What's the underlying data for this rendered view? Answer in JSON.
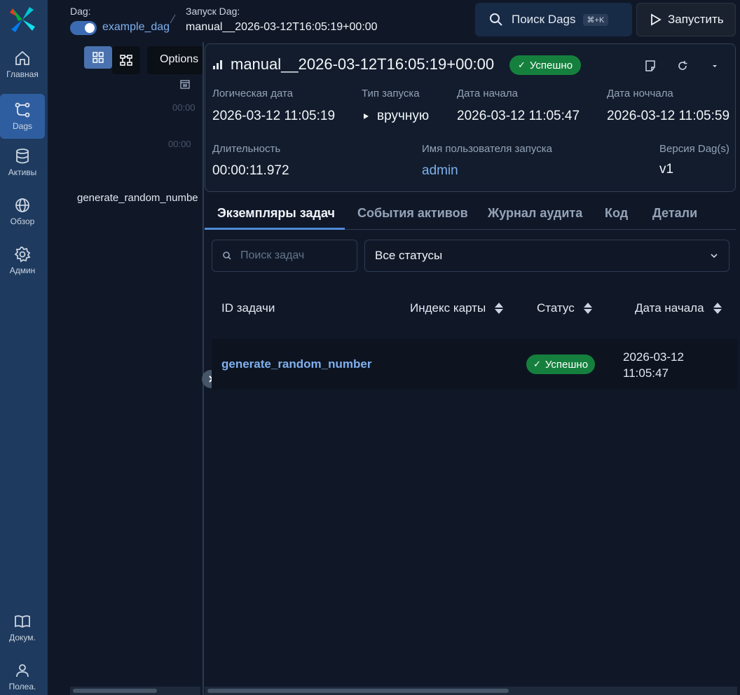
{
  "sidebar": {
    "items": [
      {
        "label": "Главная",
        "icon": "home-icon"
      },
      {
        "label": "Dags",
        "icon": "dags-icon",
        "active": true
      },
      {
        "label": "Активы",
        "icon": "database-icon"
      },
      {
        "label": "Обзор",
        "icon": "globe-icon"
      },
      {
        "label": "Админ",
        "icon": "gear-icon"
      },
      {
        "label": "Докум.",
        "icon": "book-icon"
      },
      {
        "label": "Полеа.",
        "icon": "user-icon"
      }
    ]
  },
  "breadcrumb": {
    "dag_label": "Dag:",
    "dag_name": "example_dag",
    "run_label": "Запуск Dag:",
    "run_name": "manual__2026-03-12T16:05:19+00:00"
  },
  "header": {
    "search_label": "Поиск Dags",
    "search_shortcut": "⌘+K",
    "run_button": "Запустить"
  },
  "left_panel": {
    "options_label": "Options",
    "time_ticks": [
      "00:00",
      "00:00"
    ],
    "task_label": "generate_random_number"
  },
  "run": {
    "title": "manual__2026-03-12T16:05:19+00:00",
    "status": "Успешно",
    "fields": {
      "logical_date_label": "Логическая дата",
      "logical_date": "2026-03-12 11:05:19",
      "run_type_label": "Тип запуска",
      "run_type": "вручную",
      "start_date_label": "Дата начала",
      "start_date": "2026-03-12 11:05:47",
      "end_date_label": "Дата ноччала",
      "end_date": "2026-03-12 11:05:59",
      "duration_label": "Длительность",
      "duration": "00:00:11.972",
      "triggered_by_label": "Имя пользователя запуска",
      "triggered_by": "admin",
      "version_label": "Версия Dag(s)",
      "version": "v1"
    }
  },
  "tabs": [
    "Экземпляры задач",
    "События активов",
    "Журнал аудита",
    "Код",
    "Детали"
  ],
  "filters": {
    "search_placeholder": "Поиск задач",
    "status_value": "Все статусы"
  },
  "table": {
    "headers": [
      "ID задачи",
      "Индекс карты",
      "Статус",
      "Дата начала"
    ],
    "rows": [
      {
        "task_id": "generate_random_number",
        "status": "Успешно",
        "start_date_line1": "2026-03-12",
        "start_date_line2": "11:05:47"
      }
    ]
  },
  "colors": {
    "success": "#15803d",
    "accent": "#4f8bd6",
    "sidebar": "#1e3a5f"
  }
}
